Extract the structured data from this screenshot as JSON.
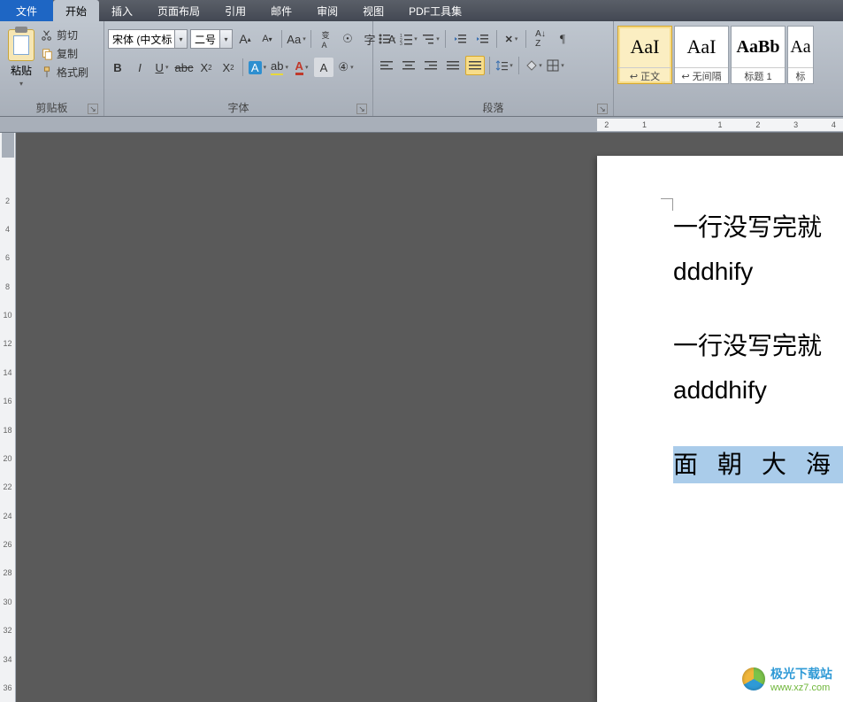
{
  "tabs": {
    "file": "文件",
    "items": [
      "开始",
      "插入",
      "页面布局",
      "引用",
      "邮件",
      "审阅",
      "视图",
      "PDF工具集"
    ],
    "active_index": 0
  },
  "clipboard": {
    "paste": "粘贴",
    "cut": "剪切",
    "copy": "复制",
    "format_painter": "格式刷",
    "group": "剪贴板"
  },
  "font": {
    "name": "宋体 (中文标",
    "size": "二号",
    "group": "字体"
  },
  "paragraph": {
    "group": "段落"
  },
  "styles": {
    "items": [
      {
        "preview": "AaI",
        "label": "↩ 正文",
        "size": "22px",
        "color": "#000"
      },
      {
        "preview": "AaI",
        "label": "↩ 无间隔",
        "size": "22px",
        "color": "#000"
      },
      {
        "preview": "AaBb",
        "label": "标题 1",
        "size": "20px",
        "color": "#000",
        "bold": true
      },
      {
        "preview": "Aa",
        "label": "标",
        "size": "20px",
        "color": "#000"
      }
    ],
    "active_index": 0
  },
  "ruler_h_labels": [
    "2",
    "",
    "1",
    "",
    "",
    "",
    "1",
    "",
    "2",
    "",
    "3",
    "",
    "4"
  ],
  "ruler_v_labels": [
    "",
    "2",
    "4",
    "6",
    "8",
    "10",
    "12",
    "14",
    "16",
    "18",
    "20",
    "22",
    "24",
    "26",
    "28",
    "30",
    "32",
    "34",
    "36"
  ],
  "document": {
    "lines": [
      "一行没写完就",
      "dddhify",
      "",
      "一行没写完就",
      "adddhify",
      "",
      "面朝大海"
    ],
    "selected_line_index": 6
  },
  "watermark": {
    "name": "极光下载站",
    "url": "www.xz7.com"
  }
}
